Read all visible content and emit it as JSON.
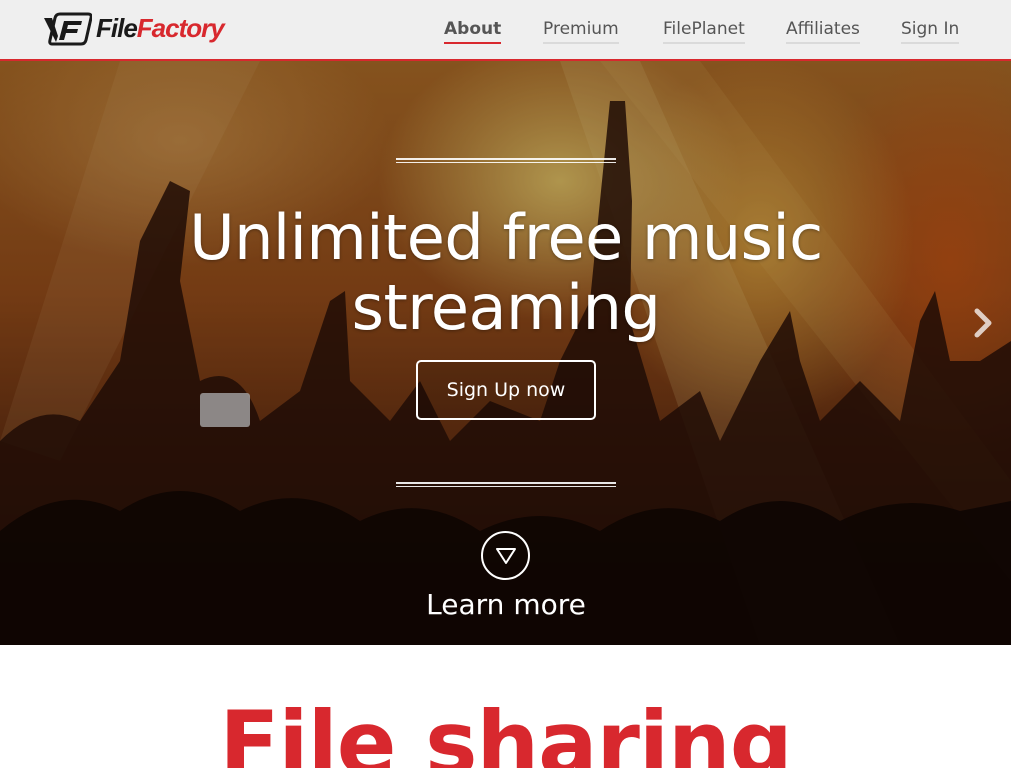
{
  "brand": {
    "name_part1": "File",
    "name_part2": "Factory",
    "accent_color": "#d8282e"
  },
  "nav": {
    "items": [
      {
        "label": "About",
        "active": true
      },
      {
        "label": "Premium",
        "active": false
      },
      {
        "label": "FilePlanet",
        "active": false
      },
      {
        "label": "Affiliates",
        "active": false
      },
      {
        "label": "Sign In",
        "active": false
      }
    ]
  },
  "hero": {
    "headline_line1": "Unlimited free music",
    "headline_line2": "streaming",
    "cta_label": "Sign Up now",
    "learn_more_label": "Learn more",
    "learn_more_icon": "triangle-down-icon",
    "next_icon": "chevron-right-icon"
  },
  "section": {
    "title": "File sharing"
  }
}
